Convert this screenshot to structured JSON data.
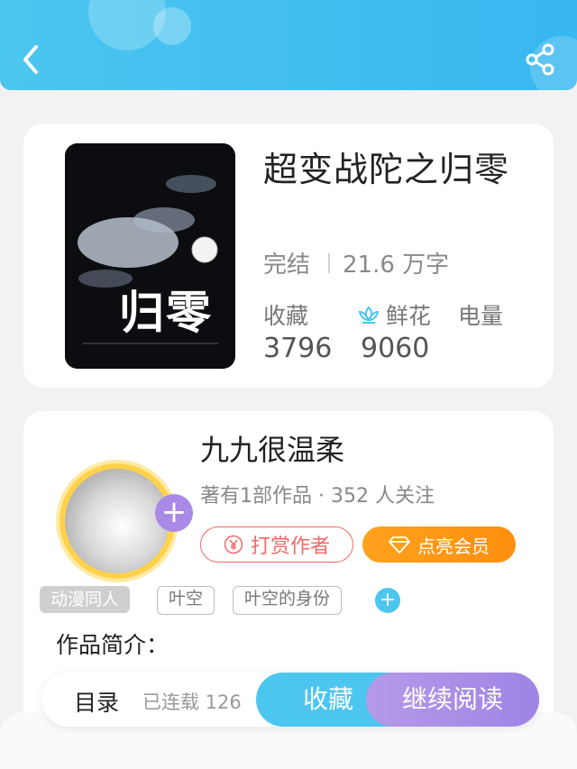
{
  "book": {
    "title": "超变战陀之归零",
    "status": "完结",
    "word_count": "21.6 万字",
    "cover_text": "归零",
    "stats": [
      {
        "label": "收藏",
        "value": "3796"
      },
      {
        "label": "鲜花",
        "value": "9060",
        "icon": "lotus-flower-icon"
      },
      {
        "label": "电量",
        "value": ""
      }
    ]
  },
  "author": {
    "name": "九九很温柔",
    "meta": "著有1部作品 · 352 人关注",
    "reward_label": "打赏作者",
    "vip_label": "点亮会员",
    "follow_symbol": "+"
  },
  "tags": [
    "动漫同人",
    "叶空",
    "叶空的身份"
  ],
  "tag_add_symbol": "+",
  "intro_label": "作品简介：",
  "bottom_bar": {
    "toc_label": "目录",
    "toc_progress": "已连载 126",
    "collect_label": "收藏",
    "read_label": "继续阅读"
  },
  "colors": {
    "header": "#3fbdf0",
    "accent_blue": "#4cc6ef",
    "accent_purple": "#a98ae6",
    "reward": "#f06a6a",
    "vip": "#ff9a18"
  }
}
